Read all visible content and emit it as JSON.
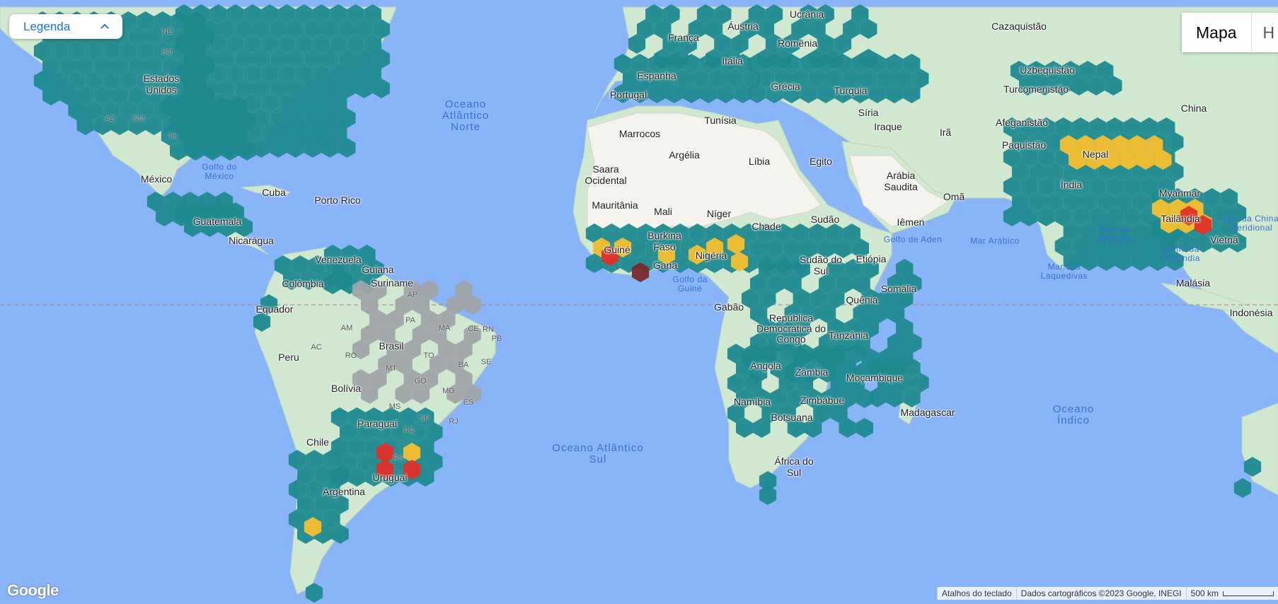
{
  "legend": {
    "label": "Legenda"
  },
  "map_type": {
    "map": "Mapa",
    "hybrid": "H"
  },
  "footer": {
    "shortcuts": "Atalhos do teclado",
    "credits": "Dados cartográficos ©2023 Google, INEGI",
    "scale": "500 km"
  },
  "logo": "Google",
  "colors": {
    "ocean": "#8ab4f8",
    "teal": "#1e8a8f",
    "yellow": "#f5c02e",
    "red": "#e0302a",
    "darkred": "#7a2a2a",
    "gray": "#a0a4a8"
  },
  "places": [
    {
      "t": "Ucrânia"
    },
    {
      "t": "Cazaquistão"
    },
    {
      "t": "Áustria"
    },
    {
      "t": "França"
    },
    {
      "t": "Romênia"
    },
    {
      "t": "Itália"
    },
    {
      "t": "Espanha"
    },
    {
      "t": "Portugal"
    },
    {
      "t": "Grécia"
    },
    {
      "t": "Turquia"
    },
    {
      "t": "Uzbequistão"
    },
    {
      "t": "Turcomenistão"
    },
    {
      "t": "China"
    },
    {
      "t": "Síria"
    },
    {
      "t": "Iraque"
    },
    {
      "t": "Irã"
    },
    {
      "t": "Afeganistão"
    },
    {
      "t": "Paquistão"
    },
    {
      "t": "Nepal"
    },
    {
      "t": "Índia"
    },
    {
      "t": "Myanmar"
    },
    {
      "t": "Tailândia"
    },
    {
      "t": "Vietnã"
    },
    {
      "t": "Malásia"
    },
    {
      "t": "Indonésia"
    },
    {
      "t": "Tunísia"
    },
    {
      "t": "Marrocos"
    },
    {
      "t": "Argélia"
    },
    {
      "t": "Líbia"
    },
    {
      "t": "Egito"
    },
    {
      "t": "Saara Ocidental"
    },
    {
      "t": "Mauritânia"
    },
    {
      "t": "Mali"
    },
    {
      "t": "Níger"
    },
    {
      "t": "Chade"
    },
    {
      "t": "Sudão"
    },
    {
      "t": "Arábia Saudita"
    },
    {
      "t": "Omã"
    },
    {
      "t": "Iêmen"
    },
    {
      "t": "Burkina Faso"
    },
    {
      "t": "Guiné"
    },
    {
      "t": "Gana"
    },
    {
      "t": "Nigéria"
    },
    {
      "t": "Sudão do Sul"
    },
    {
      "t": "Etiópia"
    },
    {
      "t": "Somália"
    },
    {
      "t": "Quênia"
    },
    {
      "t": "Gabão"
    },
    {
      "t": "República Democrática do Congo"
    },
    {
      "t": "Tanzânia"
    },
    {
      "t": "Angola"
    },
    {
      "t": "Zâmbia"
    },
    {
      "t": "Moçambique"
    },
    {
      "t": "Namíbia"
    },
    {
      "t": "Zimbábue"
    },
    {
      "t": "Botsuana"
    },
    {
      "t": "Madagascar"
    },
    {
      "t": "África do Sul"
    },
    {
      "t": "Estados Unidos"
    },
    {
      "t": "México"
    },
    {
      "t": "Cuba"
    },
    {
      "t": "Porto Rico"
    },
    {
      "t": "Guatemala"
    },
    {
      "t": "Nicarágua"
    },
    {
      "t": "Venezuela"
    },
    {
      "t": "Guiana"
    },
    {
      "t": "Suriname"
    },
    {
      "t": "Colômbia"
    },
    {
      "t": "Equador"
    },
    {
      "t": "Peru"
    },
    {
      "t": "Brasil"
    },
    {
      "t": "Bolívia"
    },
    {
      "t": "Paraguai"
    },
    {
      "t": "Chile"
    },
    {
      "t": "Argentina"
    },
    {
      "t": "Uruguai"
    }
  ],
  "states": [
    "ND",
    "SD",
    "NM",
    "AZ",
    "TX",
    "AP",
    "AM",
    "PA",
    "MA",
    "CE",
    "RN",
    "PB",
    "AC",
    "RO",
    "MT",
    "TO",
    "BA",
    "SE",
    "GO",
    "MS",
    "SP",
    "MG",
    "ES",
    "RJ",
    "PR",
    "RS"
  ],
  "waters": [
    {
      "t": "Oceano Atlântico Norte"
    },
    {
      "t": "Oceano Atlântico Sul"
    },
    {
      "t": "Oceano Índico"
    },
    {
      "t": "Golfo do México"
    },
    {
      "t": "Golfo da Guiné"
    },
    {
      "t": "Golfo de Aden"
    },
    {
      "t": "Mar Arábico"
    },
    {
      "t": "Baía de Bengala"
    },
    {
      "t": "Mar das Laquedivas"
    },
    {
      "t": "Golfo da Tailândia"
    },
    {
      "t": "Mar da China Meridional"
    }
  ]
}
